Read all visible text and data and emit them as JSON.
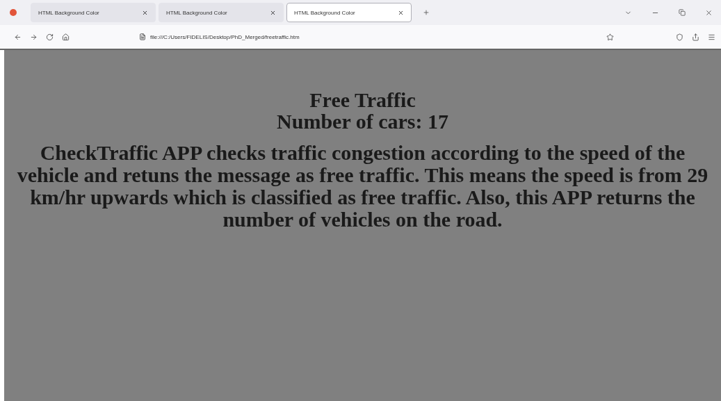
{
  "tabs": [
    {
      "label": "HTML Background Color",
      "selected": false
    },
    {
      "label": "HTML Background Color",
      "selected": false
    },
    {
      "label": "HTML Background Color",
      "selected": true
    }
  ],
  "address_bar": {
    "url": "file:///C:/Users/FIDELIS/Desktop/PhD_Merged/freetraffic.htm"
  },
  "page": {
    "title": "Free Traffic",
    "count": "Number of cars: 17",
    "description": "CheckTraffic APP checks traffic congestion according to the speed of the vehicle and retuns the message as free traffic. This means the speed is from 29 km/hr upwards which is classified as free traffic. Also, this APP returns the number of vehicles on the road."
  }
}
